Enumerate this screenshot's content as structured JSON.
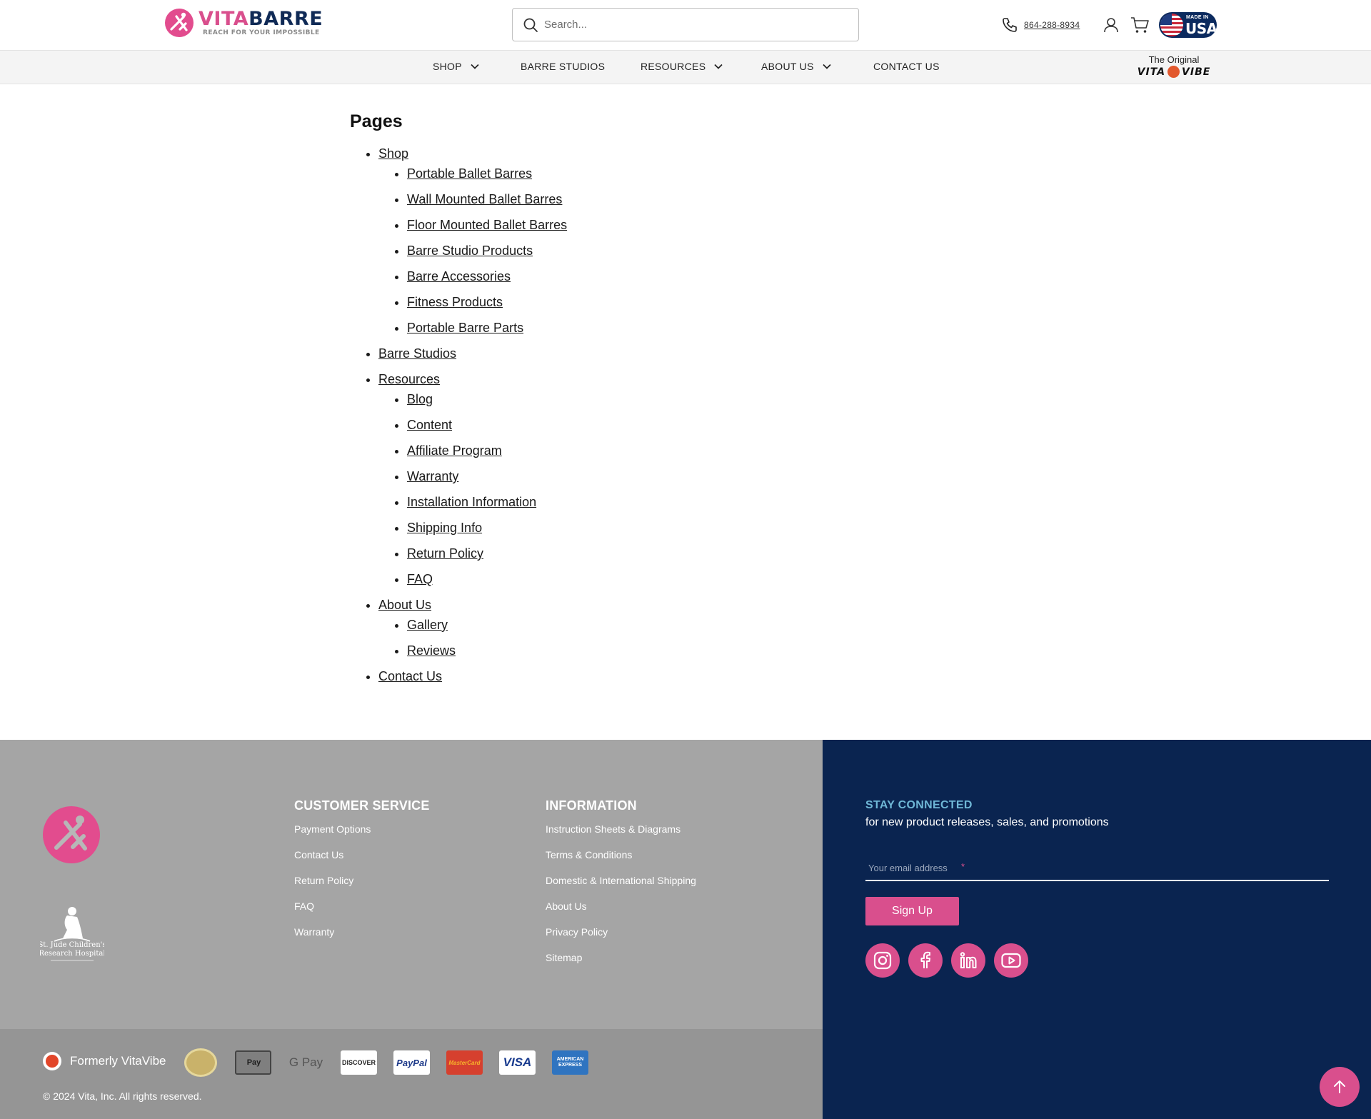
{
  "header": {
    "logo": {
      "word1": "VITA",
      "word2": "BARRE",
      "tagline": "REACH FOR YOUR IMPOSSIBLE"
    },
    "search_placeholder": "Search...",
    "phone": "864-288-8934",
    "made_in_usa": {
      "line1": "MADE IN",
      "line2": "USA"
    },
    "nav": [
      {
        "label": "SHOP",
        "dropdown": true
      },
      {
        "label": "BARRE STUDIOS",
        "dropdown": false
      },
      {
        "label": "RESOURCES",
        "dropdown": true
      },
      {
        "label": "ABOUT US",
        "dropdown": true
      },
      {
        "label": "CONTACT US",
        "dropdown": false
      }
    ],
    "original_badge": {
      "line1": "The Original",
      "word1": "VITA",
      "word2": "VIBE"
    }
  },
  "main": {
    "title": "Pages",
    "tree": [
      {
        "label": "Shop",
        "children": [
          "Portable Ballet Barres",
          "Wall Mounted Ballet Barres",
          "Floor Mounted Ballet Barres",
          "Barre Studio Products",
          "Barre Accessories",
          "Fitness Products",
          "Portable Barre Parts"
        ]
      },
      {
        "label": "Barre Studios",
        "children": []
      },
      {
        "label": "Resources",
        "children": [
          "Blog",
          "Content",
          "Affiliate Program",
          "Warranty",
          "Installation Information",
          "Shipping Info",
          "Return Policy",
          "FAQ"
        ]
      },
      {
        "label": "About Us",
        "children": [
          "Gallery",
          "Reviews"
        ]
      },
      {
        "label": "Contact Us",
        "children": []
      }
    ]
  },
  "footer": {
    "stjude_text": "St. Jude Children's Research Hospital",
    "customer_service": {
      "title": "CUSTOMER SERVICE",
      "links": [
        "Payment Options",
        "Contact Us",
        "Return Policy",
        "FAQ",
        "Warranty"
      ]
    },
    "information": {
      "title": "INFORMATION",
      "links": [
        "Instruction Sheets & Diagrams",
        "Terms & Conditions",
        "Domestic & International Shipping",
        "About Us",
        "Privacy Policy",
        "Sitemap"
      ]
    },
    "formerly": "Formerly VitaVibe",
    "payments": [
      {
        "icon": "authorize-net-seal-icon",
        "label": ""
      },
      {
        "icon": "apple-pay-icon",
        "label": "Pay"
      },
      {
        "icon": "google-pay-icon",
        "label": "G Pay"
      },
      {
        "icon": "discover-icon",
        "label": "DISCOVER"
      },
      {
        "icon": "paypal-icon",
        "label": "PayPal"
      },
      {
        "icon": "mastercard-icon",
        "label": "MasterCard"
      },
      {
        "icon": "visa-icon",
        "label": "VISA"
      },
      {
        "icon": "american-express-icon",
        "label": "AMERICAN EXPRESS"
      }
    ],
    "copyright": "© 2024 Vita, Inc. All rights reserved.",
    "newsletter": {
      "title": "STAY CONNECTED",
      "subtitle": "for new product releases, sales, and promotions",
      "email_placeholder": "Your email address",
      "required_mark": "*",
      "button": "Sign Up"
    },
    "social": [
      "instagram-icon",
      "facebook-icon",
      "linkedin-icon",
      "youtube-icon"
    ]
  },
  "colors": {
    "brand_pink": "#d94f8d",
    "brand_navy": "#0a2450",
    "footer_gray": "#a5a5a5",
    "accent_blue": "#6fb7d6"
  }
}
